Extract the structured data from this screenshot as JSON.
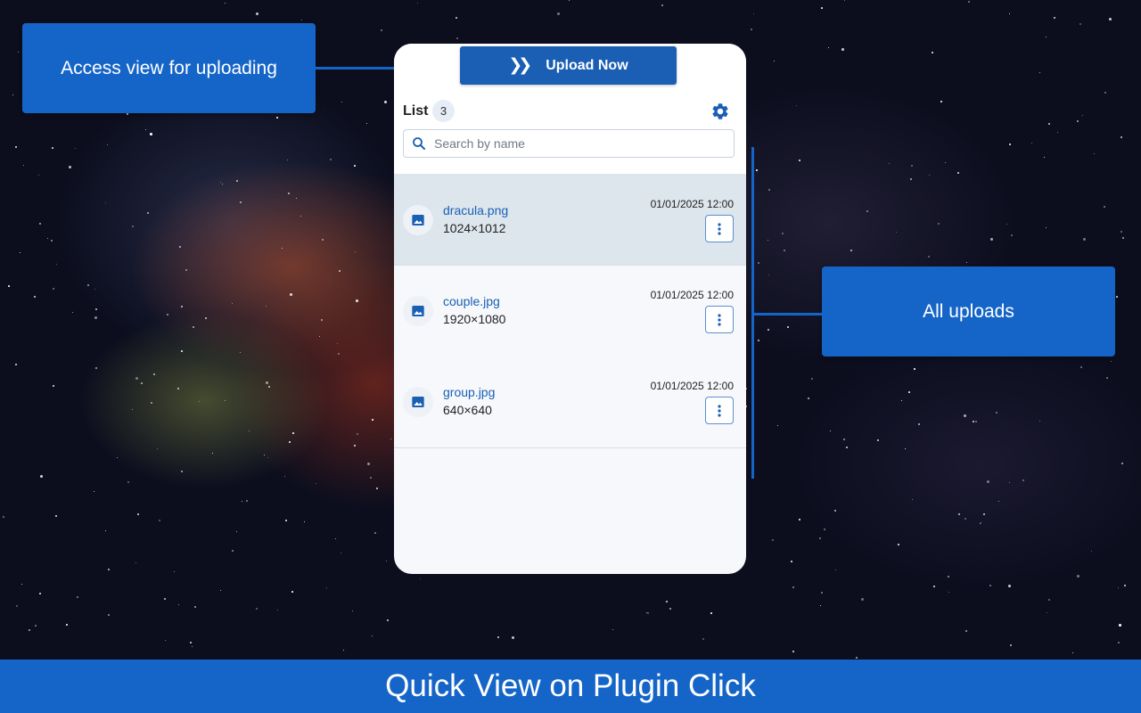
{
  "callouts": {
    "upload": "Access view for uploading",
    "uploads": "All uploads"
  },
  "panel": {
    "upload_button": "Upload Now",
    "list_label": "List",
    "count": "3",
    "search_placeholder": "Search by name",
    "files": [
      {
        "name": "dracula.png",
        "dimensions": "1024×1012",
        "date": "01/01/2025 12:00",
        "selected": true
      },
      {
        "name": "couple.jpg",
        "dimensions": "1920×1080",
        "date": "01/01/2025 12:00",
        "selected": false
      },
      {
        "name": "group.jpg",
        "dimensions": "640×640",
        "date": "01/01/2025 12:00",
        "selected": false
      }
    ]
  },
  "caption": "Quick View on Plugin Click",
  "colors": {
    "accent": "#1565c8",
    "button": "#1a5fb4",
    "selected_row": "#dde5ed"
  },
  "icons": [
    "double-chevron-right-icon",
    "gear-icon",
    "search-icon",
    "image-icon",
    "more-vertical-icon"
  ]
}
